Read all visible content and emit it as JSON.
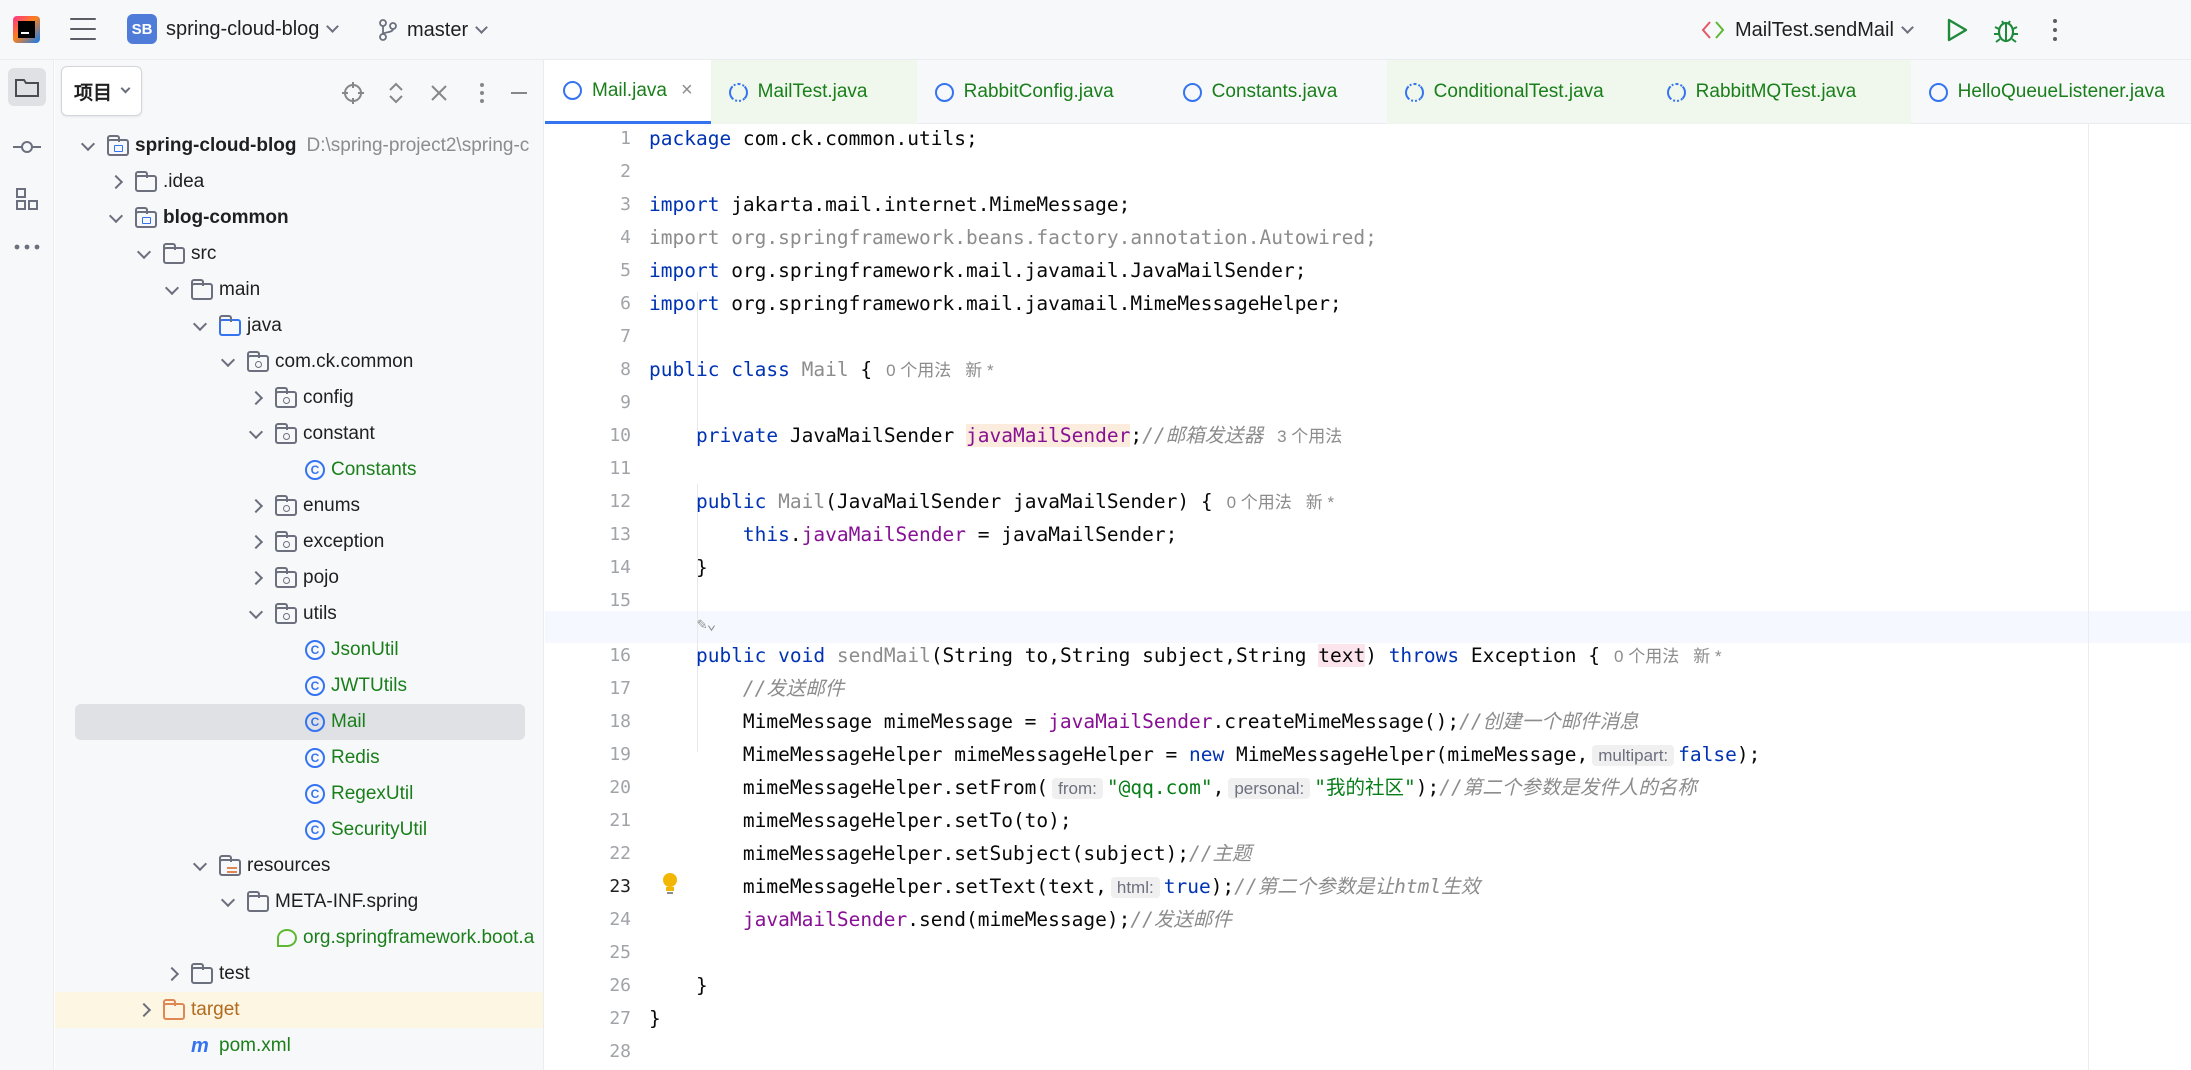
{
  "topbar": {
    "project_badge": "SB",
    "project_name": "spring-cloud-blog",
    "branch": "master",
    "run_config": "MailTest.sendMail"
  },
  "project_panel": {
    "title": "项目",
    "tree": [
      {
        "label": "spring-cloud-blog",
        "path": "D:\\spring-project2\\spring-c"
      },
      {
        "label": ".idea"
      },
      {
        "label": "blog-common"
      },
      {
        "label": "src"
      },
      {
        "label": "main"
      },
      {
        "label": "java"
      },
      {
        "label": "com.ck.common"
      },
      {
        "label": "config"
      },
      {
        "label": "constant"
      },
      {
        "label": "Constants"
      },
      {
        "label": "enums"
      },
      {
        "label": "exception"
      },
      {
        "label": "pojo"
      },
      {
        "label": "utils"
      },
      {
        "label": "JsonUtil"
      },
      {
        "label": "JWTUtils"
      },
      {
        "label": "Mail"
      },
      {
        "label": "Redis"
      },
      {
        "label": "RegexUtil"
      },
      {
        "label": "SecurityUtil"
      },
      {
        "label": "resources"
      },
      {
        "label": "META-INF.spring"
      },
      {
        "label": "org.springframework.boot.a"
      },
      {
        "label": "test"
      },
      {
        "label": "target"
      },
      {
        "label": "pom.xml"
      }
    ]
  },
  "editor": {
    "tabs": [
      {
        "label": "Mail.java"
      },
      {
        "label": "MailTest.java"
      },
      {
        "label": "RabbitConfig.java"
      },
      {
        "label": "Constants.java"
      },
      {
        "label": "ConditionalTest.java"
      },
      {
        "label": "RabbitMQTest.java"
      },
      {
        "label": "HelloQueueListener.java"
      }
    ],
    "line_numbers": [
      "1",
      "2",
      "3",
      "4",
      "5",
      "6",
      "7",
      "8",
      "9",
      "10",
      "11",
      "12",
      "13",
      "14",
      "15",
      "16",
      "17",
      "18",
      "19",
      "20",
      "21",
      "22",
      "23",
      "24",
      "25",
      "26",
      "27",
      "28"
    ],
    "code": {
      "l1_kw": "package",
      "l1_rest": " com.ck.common.utils;",
      "import": "import",
      "l3": " jakarta.mail.internet.MimeMessage;",
      "l4": "import org.springframework.beans.factory.annotation.Autowired;",
      "l5": " org.springframework.mail.javamail.JavaMailSender;",
      "l6": " org.springframework.mail.javamail.MimeMessageHelper;",
      "public": "public",
      "class": "class",
      "private": "private",
      "class_name": "Mail",
      "open_brace": " {",
      "usage0": "0 个用法",
      "new_star": "新 *",
      "l10_type": " JavaMailSender ",
      "l10_field": "javaMailSender",
      "l10_semi": ";",
      "l10_cmt": "//邮箱发送器",
      "usage3": "3 个用法",
      "l12_ctor": "Mail",
      "l12_rest": "(JavaMailSender javaMailSender) {",
      "this": "this",
      "l13_dot": ".",
      "l13_field": "javaMailSender",
      "l13_rest": " = javaMailSender;",
      "close_brace": "}",
      "void": "void",
      "l16_name": "sendMail",
      "l16_args": "(String to,String subject,String ",
      "l16_text": "text",
      "l16_paren": ") ",
      "throws": "throws",
      "l16_exc": " Exception {",
      "l17_cmt": "//发送邮件",
      "l18_a": "MimeMessage mimeMessage = ",
      "l18_field": "javaMailSender",
      "l18_b": ".createMimeMessage();",
      "l18_cmt": "//创建一个邮件消息",
      "l19_a": "MimeMessageHelper mimeMessageHelper = ",
      "new": "new",
      "l19_b": " MimeMessageHelper(mimeMessage,",
      "hint_multipart": "multipart:",
      "false": "false",
      "l19_c": ");",
      "l20_a": "mimeMessageHelper.setFrom(",
      "hint_from": "from:",
      "l20_str1": "\"@qq.com\"",
      "comma": ",",
      "hint_personal": "personal:",
      "l20_str2": "\"我的社区\"",
      "l20_b": ");",
      "l20_cmt": "//第二个参数是发件人的名称",
      "l21": "mimeMessageHelper.setTo(to);",
      "l22_a": "mimeMessageHelper.setSubject(subject);",
      "l22_cmt": "//主题",
      "l23_a": "mimeMessageHelper.setText(text,",
      "hint_html": "html:",
      "true": "true",
      "l23_b": ");",
      "l23_cmt": "//第二个参数是让html生效",
      "l24_field": "javaMailSender",
      "l24_b": ".send(mimeMessage);",
      "l24_cmt": "//发送邮件"
    }
  }
}
